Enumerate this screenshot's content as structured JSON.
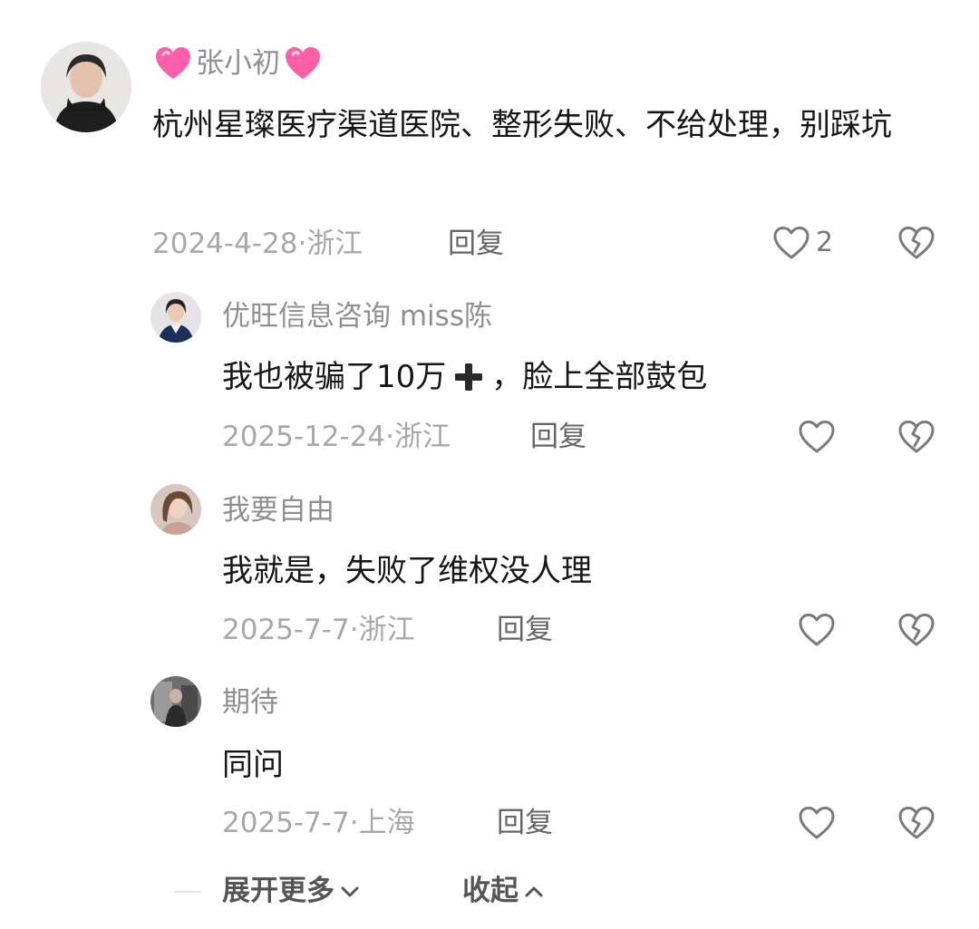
{
  "comments": [
    {
      "username_prefix_icon": "pink-heart-emoji",
      "username": "张小初",
      "username_suffix_icon": "pink-heart-emoji",
      "text": "杭州星璨医疗渠道医院、整形失败、不给处理，别踩坑",
      "date": "2024-4-28",
      "location": "浙江",
      "reply_label": "回复",
      "like_count": "2",
      "like_icon": "heart-outline-icon",
      "dislike_icon": "broken-heart-icon",
      "avatar_icon": "user-avatar"
    },
    {
      "username": "优旺信息咨询 miss陈",
      "text_before": "我也被骗了10万",
      "text_icon": "heavy-plus-icon",
      "text_after": "，脸上全部鼓包",
      "date": "2025-12-24",
      "location": "浙江",
      "reply_label": "回复",
      "like_icon": "heart-outline-icon",
      "dislike_icon": "broken-heart-icon",
      "avatar_icon": "user-avatar"
    },
    {
      "username": "我要自由",
      "text": "我就是，失败了维权没人理",
      "date": "2025-7-7",
      "location": "浙江",
      "reply_label": "回复",
      "like_icon": "heart-outline-icon",
      "dislike_icon": "broken-heart-icon",
      "avatar_icon": "user-avatar"
    },
    {
      "username": "期待",
      "text": "同问",
      "date": "2025-7-7",
      "location": "上海",
      "reply_label": "回复",
      "like_icon": "heart-outline-icon",
      "dislike_icon": "broken-heart-icon",
      "avatar_icon": "user-avatar"
    }
  ],
  "footer": {
    "expand_label": "展开更多",
    "expand_icon": "chevron-down-icon",
    "collapse_label": "收起",
    "collapse_icon": "chevron-up-icon"
  },
  "colors": {
    "username": "#8f8f8f",
    "text": "#161616",
    "meta": "#a8a8a8",
    "heart_emoji": "#ff5fa8"
  }
}
